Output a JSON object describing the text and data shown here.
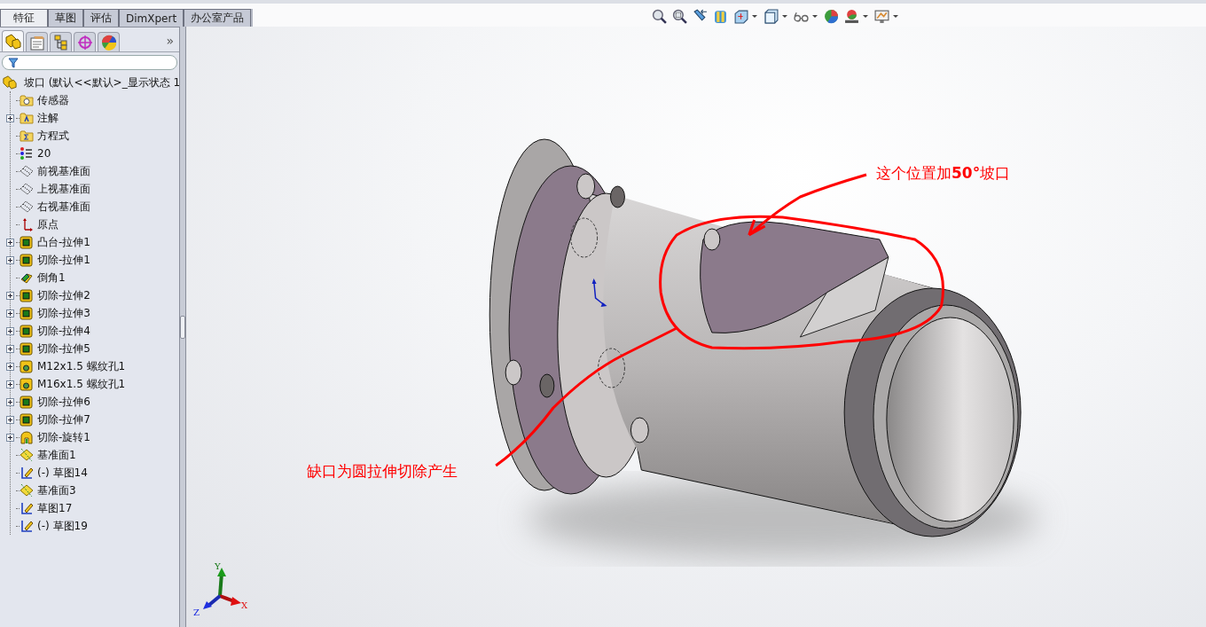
{
  "command_tabs": [
    {
      "label": "特征",
      "selected": true
    },
    {
      "label": "草图",
      "selected": false
    },
    {
      "label": "评估",
      "selected": false
    },
    {
      "label": "DimXpert",
      "selected": false
    },
    {
      "label": "办公室产品",
      "selected": false
    }
  ],
  "panel_tabs": [
    {
      "kind": "feature-tree",
      "selected": true
    },
    {
      "kind": "property",
      "selected": false
    },
    {
      "kind": "configuration",
      "selected": false
    },
    {
      "kind": "dimxpert",
      "selected": false
    },
    {
      "kind": "display",
      "selected": false
    }
  ],
  "panel_more": "»",
  "feature_tree": {
    "label": "坡口  (默认<<默认>_显示状态 1",
    "kind": "part",
    "children": [
      {
        "label": "传感器",
        "kind": "sensor",
        "expander": false
      },
      {
        "label": "注解",
        "kind": "annotation",
        "expander": true
      },
      {
        "label": "方程式",
        "kind": "equation",
        "expander": false
      },
      {
        "label": "20",
        "kind": "material",
        "expander": false
      },
      {
        "label": "前视基准面",
        "kind": "plane",
        "expander": false
      },
      {
        "label": "上视基准面",
        "kind": "plane",
        "expander": false
      },
      {
        "label": "右视基准面",
        "kind": "plane",
        "expander": false
      },
      {
        "label": "原点",
        "kind": "origin",
        "expander": false
      },
      {
        "label": "凸台-拉伸1",
        "kind": "boss",
        "expander": true
      },
      {
        "label": "切除-拉伸1",
        "kind": "cut",
        "expander": true
      },
      {
        "label": "倒角1",
        "kind": "chamfer",
        "expander": false
      },
      {
        "label": "切除-拉伸2",
        "kind": "cut",
        "expander": true
      },
      {
        "label": "切除-拉伸3",
        "kind": "cut",
        "expander": true
      },
      {
        "label": "切除-拉伸4",
        "kind": "cut",
        "expander": true
      },
      {
        "label": "切除-拉伸5",
        "kind": "cut",
        "expander": true
      },
      {
        "label": "M12x1.5 螺纹孔1",
        "kind": "hole",
        "expander": true
      },
      {
        "label": "M16x1.5 螺纹孔1",
        "kind": "hole",
        "expander": true
      },
      {
        "label": "切除-拉伸6",
        "kind": "cut",
        "expander": true
      },
      {
        "label": "切除-拉伸7",
        "kind": "cut",
        "expander": true
      },
      {
        "label": "切除-旋转1",
        "kind": "revolve",
        "expander": true
      },
      {
        "label": "基准面1",
        "kind": "refplane",
        "expander": false
      },
      {
        "label": "(-) 草图14",
        "kind": "sketch",
        "expander": false
      },
      {
        "label": "基准面3",
        "kind": "refplane",
        "expander": false
      },
      {
        "label": "草图17",
        "kind": "sketch",
        "expander": false
      },
      {
        "label": "(-) 草图19",
        "kind": "sketch",
        "expander": false
      }
    ]
  },
  "view_toolbar": [
    {
      "kind": "zoom-fit",
      "dropdown": false
    },
    {
      "kind": "zoom-area",
      "dropdown": false
    },
    {
      "kind": "previous-view",
      "dropdown": false
    },
    {
      "kind": "section-view",
      "dropdown": false
    },
    {
      "kind": "view-orientation",
      "dropdown": true
    },
    {
      "kind": "display-style",
      "dropdown": true
    },
    {
      "kind": "hide-show",
      "dropdown": true
    },
    {
      "kind": "appearance",
      "dropdown": false
    },
    {
      "kind": "scene",
      "dropdown": true
    },
    {
      "kind": "display-settings",
      "dropdown": true
    }
  ],
  "annotations": [
    {
      "kind": "top",
      "text": "这个位置加**50°**坡口"
    },
    {
      "kind": "bottom",
      "text": "缺口为圆拉伸切除产生"
    }
  ],
  "triad": {
    "x": "X",
    "y": "Y",
    "z": "Z"
  }
}
